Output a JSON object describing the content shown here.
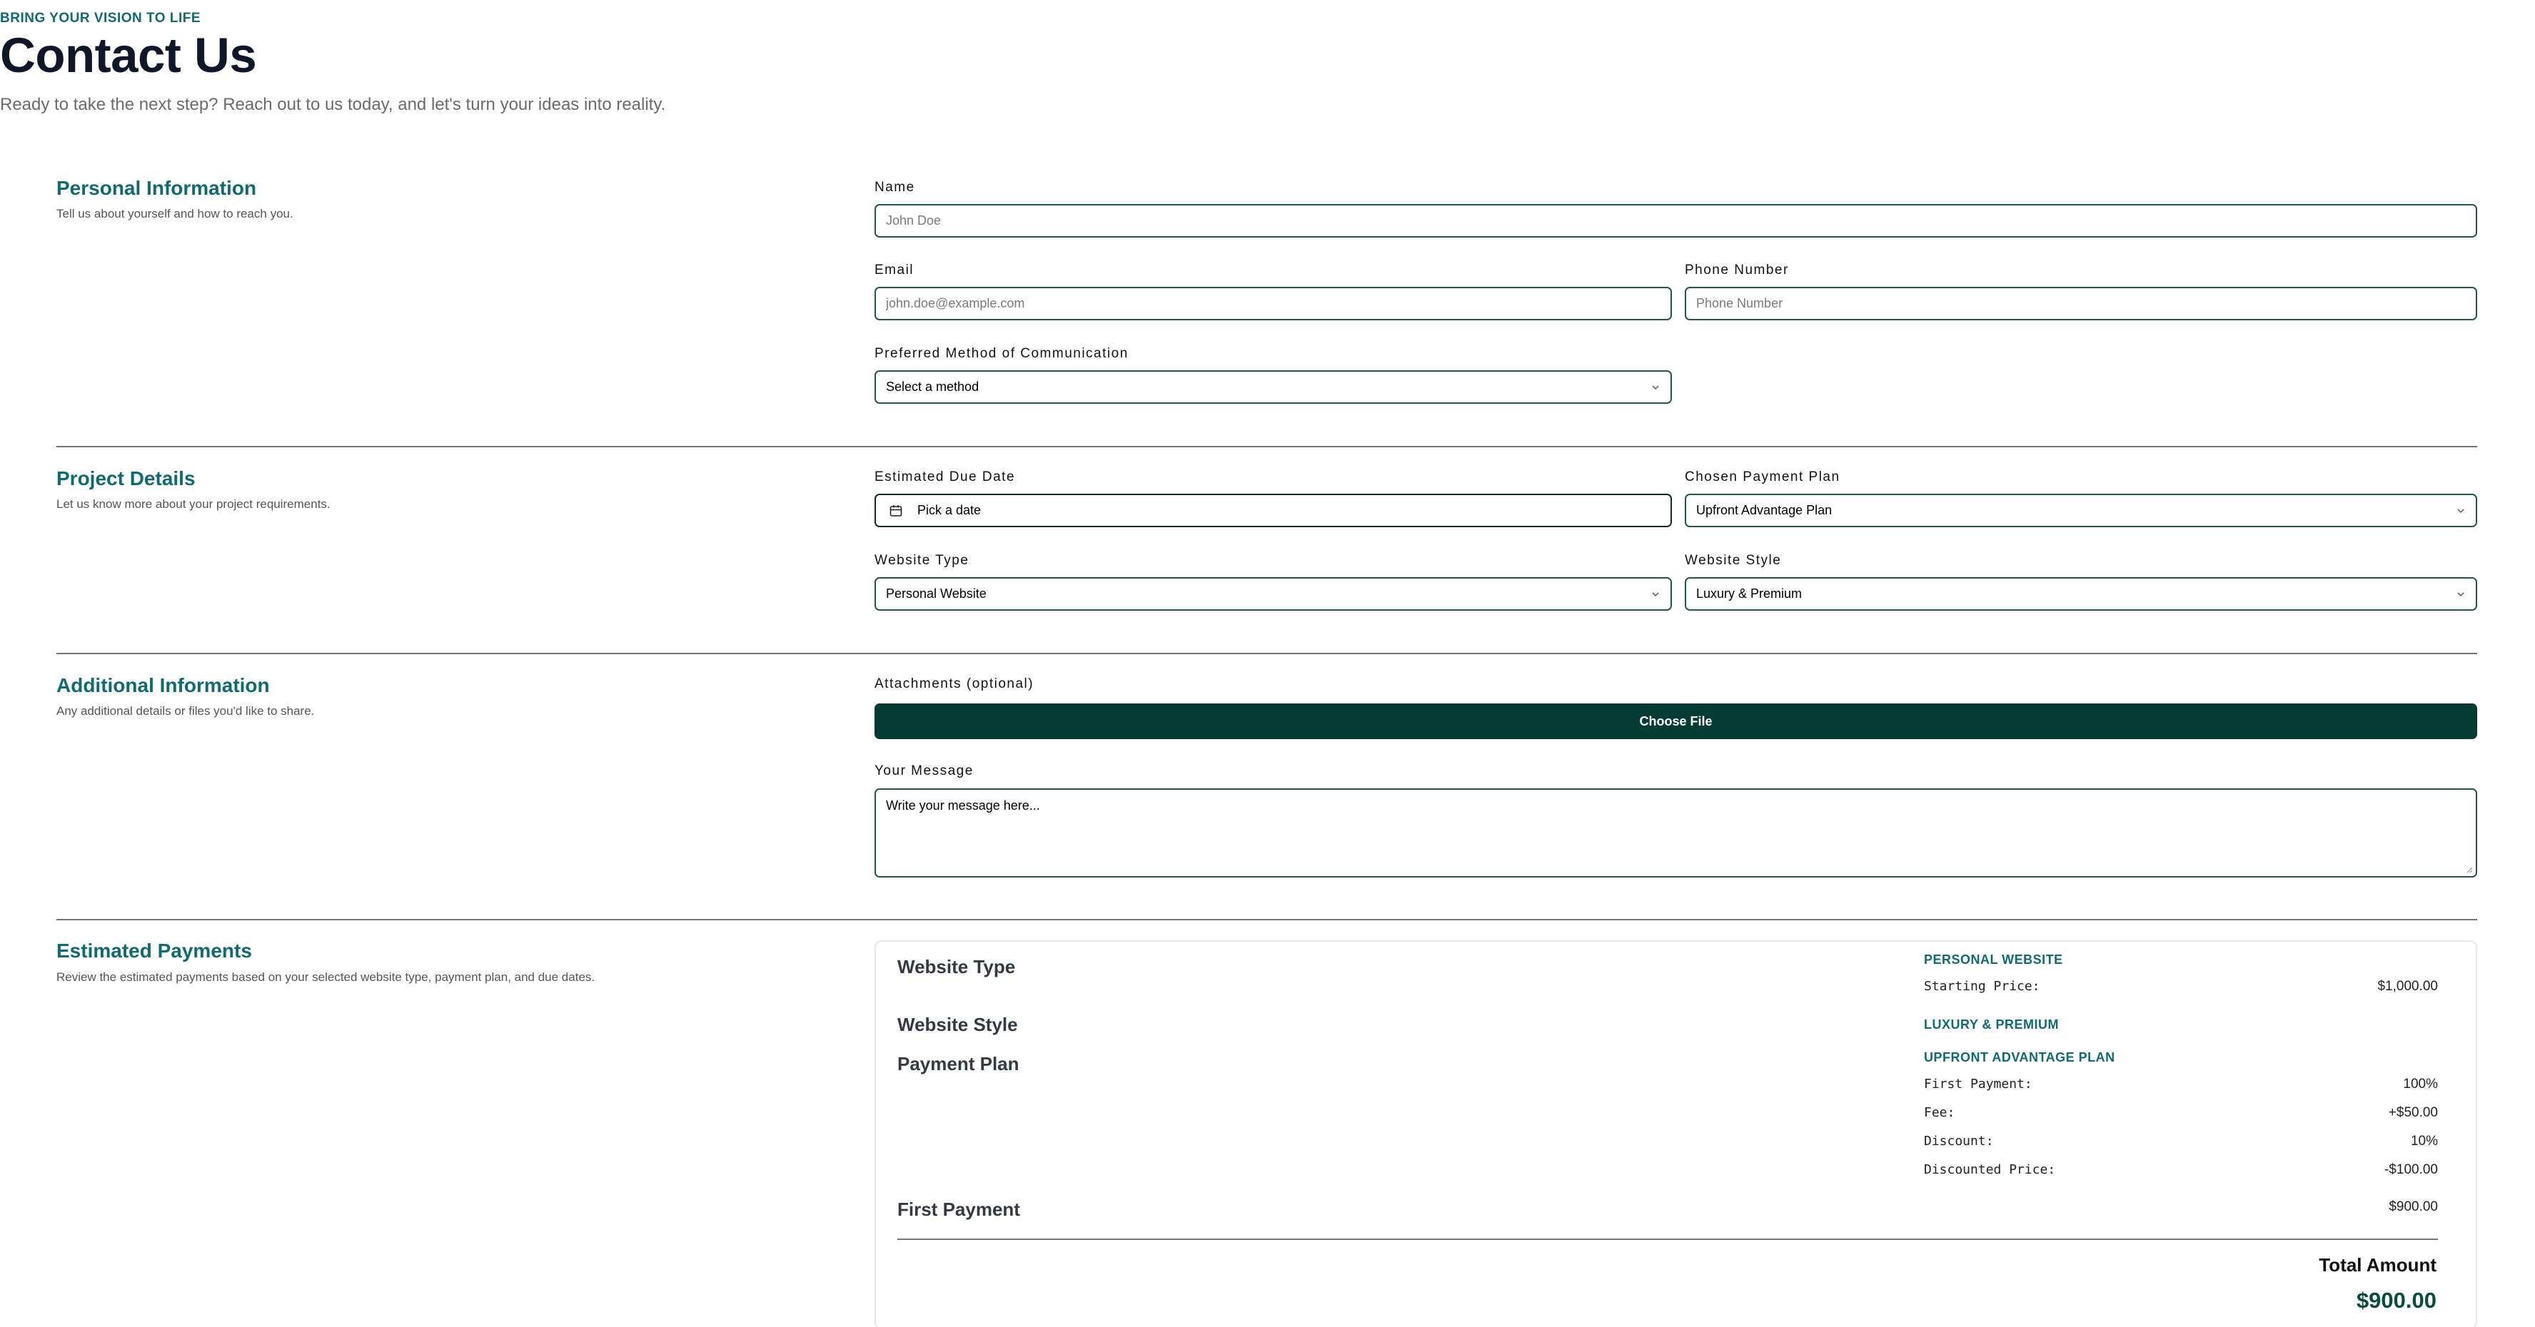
{
  "hero": {
    "eyebrow": "BRING YOUR VISION TO LIFE",
    "title": "Contact Us",
    "subtitle": "Ready to take the next step? Reach out to us today, and let's turn your ideas into reality."
  },
  "personal": {
    "title": "Personal Information",
    "description": "Tell us about yourself and how to reach you.",
    "name_label": "Name",
    "name_placeholder": "John Doe",
    "email_label": "Email",
    "email_placeholder": "john.doe@example.com",
    "phone_label": "Phone Number",
    "phone_placeholder": "Phone Number",
    "comm_label": "Preferred Method of Communication",
    "comm_value": "Select a method"
  },
  "project": {
    "title": "Project Details",
    "description": "Let us know more about your project requirements.",
    "due_label": "Estimated Due Date",
    "due_value": "Pick a date",
    "plan_label": "Chosen Payment Plan",
    "plan_value": "Upfront Advantage Plan",
    "type_label": "Website Type",
    "type_value": "Personal Website",
    "style_label": "Website Style",
    "style_value": "Luxury & Premium"
  },
  "additional": {
    "title": "Additional Information",
    "description": "Any additional details or files you'd like to share.",
    "attachments_label": "Attachments (optional)",
    "choose_file": "Choose File",
    "message_label": "Your Message",
    "message_placeholder": "Write your message here..."
  },
  "payments": {
    "title": "Estimated Payments",
    "description": "Review the estimated payments based on your selected website type, payment plan, and due dates.",
    "website_type_label": "Website Type",
    "website_style_label": "Website Style",
    "payment_plan_label": "Payment Plan",
    "first_payment_label": "First Payment",
    "type_name": "PERSONAL WEBSITE",
    "starting_price_label": "Starting Price:",
    "starting_price": "$1,000.00",
    "style_name": "LUXURY & PREMIUM",
    "plan_name": "UPFRONT ADVANTAGE PLAN",
    "first_payment_row_label": "First Payment:",
    "first_payment_pct": "100%",
    "fee_label": "Fee:",
    "fee": "+$50.00",
    "discount_label": "Discount:",
    "discount": "10%",
    "discounted_price_label": "Discounted Price:",
    "discounted_price": "-$100.00",
    "first_payment_amount": "$900.00",
    "total_label": "Total Amount",
    "total_value": "$900.00"
  }
}
